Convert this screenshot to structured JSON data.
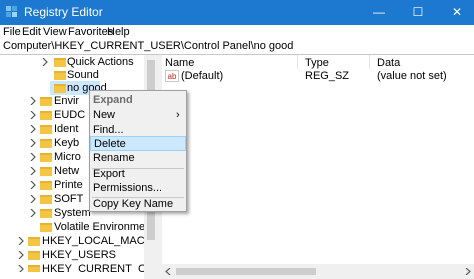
{
  "window": {
    "title": "Registry Editor",
    "minimize": "—",
    "maximize": "☐",
    "close": "✕"
  },
  "menubar": [
    "File",
    "Edit",
    "View",
    "Favorites",
    "Help"
  ],
  "address": "Computer\\HKEY_CURRENT_USER\\Control Panel\\no good",
  "tree": {
    "items": [
      "Quick Actions",
      "Sound",
      "no good",
      "Envir",
      "EUDC",
      "Ident",
      "Keyb",
      "Micro",
      "Netw",
      "Printe",
      "SOFT",
      "System",
      "Volatile Environment",
      "HKEY_LOCAL_MACHINE",
      "HKEY_USERS",
      "HKEY_CURRENT_CONFIG"
    ]
  },
  "list": {
    "columns": [
      "Name",
      "Type",
      "Data"
    ],
    "rows": [
      {
        "icon": "ab",
        "name": "(Default)",
        "type": "REG_SZ",
        "data": "(value not set)"
      }
    ]
  },
  "context_menu": {
    "items": [
      "Expand",
      "New",
      "Find...",
      "Delete",
      "Rename",
      "Export",
      "Permissions...",
      "Copy Key Name"
    ],
    "submenu_arrow": "›",
    "highlight_color": "#cce8ff"
  },
  "colors": {
    "titlebar": "#1d79d0",
    "folder": "#f4c542",
    "selection": "#cce8ff"
  }
}
